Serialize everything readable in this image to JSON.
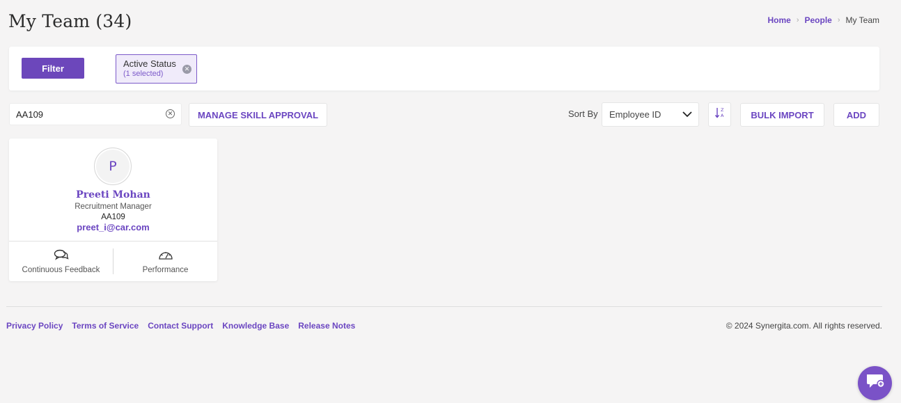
{
  "page": {
    "title": "My Team (34)"
  },
  "breadcrumb": {
    "items": [
      "Home",
      "People"
    ],
    "current": "My Team",
    "separator": "›"
  },
  "filter": {
    "button_label": "Filter",
    "chip": {
      "title": "Active Status",
      "subtitle": "(1 selected)",
      "icon": "close-circle-icon"
    }
  },
  "toolbar": {
    "search_value": "AA109",
    "search_clear_icon": "clear-circle-icon",
    "manage_skill_label": "MANAGE SKILL APPROVAL",
    "sort_label": "Sort By",
    "sort_value": "Employee ID",
    "sort_order_icon": "sort-z-a-icon",
    "bulk_import_label": "BULK IMPORT",
    "add_label": "ADD"
  },
  "employees": [
    {
      "initial": "P",
      "name": "Preeti Mohan",
      "role": "Recruitment Manager",
      "id": "AA109",
      "email": "preet_i@car.com",
      "actions": [
        {
          "label": "Continuous Feedback",
          "icon": "chat-bubbles-icon"
        },
        {
          "label": "Performance",
          "icon": "speedometer-icon"
        }
      ]
    }
  ],
  "footer": {
    "links": [
      "Privacy Policy",
      "Terms of Service",
      "Contact Support",
      "Knowledge Base",
      "Release Notes"
    ],
    "copyright": "© 2024 Synergita.com. All rights reserved."
  },
  "chat": {
    "icon": "chat-support-icon"
  },
  "colors": {
    "accent": "#6b46c1",
    "background": "#f5f4f4",
    "chip_bg": "#f0ebfa"
  }
}
